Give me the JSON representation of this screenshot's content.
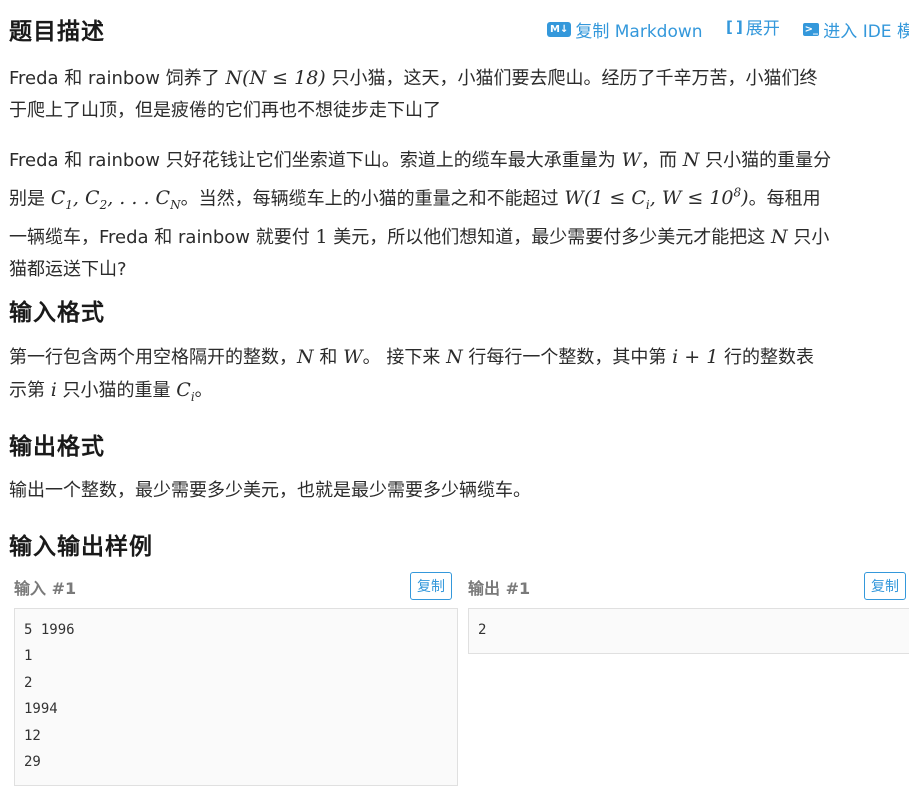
{
  "toolbar": {
    "md_icon": "M↓",
    "copy_markdown": "复制 Markdown",
    "expand_icon": "[ ]",
    "expand": "展开",
    "ide_icon": ">_",
    "ide": "进入 IDE 模式"
  },
  "sections": {
    "description": "题目描述",
    "input_format": "输入格式",
    "output_format": "输出格式",
    "samples": "输入输出样例"
  },
  "description": {
    "p1": {
      "t1": "Freda 和 rainbow 饲养了 ",
      "m1": "N(N ≤ 18)",
      "t2": " 只小猫，这天，小猫们要去爬山。经历了千辛万苦，小猫们终",
      "line2": "于爬上了山顶，但是疲倦的它们再也不想徒步走下山了"
    },
    "p2": {
      "t1": "Freda 和 rainbow 只好花钱让它们坐索道下山。索道上的缆车最大承重量为 ",
      "m_w": "W",
      "t2": "，而 ",
      "m_n": "N",
      "t3": " 只小猫的重量分",
      "t4": "别是 ",
      "m_c": "C",
      "c1": "1",
      "comma1": ", ",
      "c2": "2",
      "dots": ", . . . ",
      "cn": "N",
      "t5": "。当然，每辆缆车上的小猫的重量之和不能超过 ",
      "m_wcond1": "W(1 ≤ C",
      "sub_i": "i",
      "m_wcond2": ", W ≤ 10",
      "sup8": "8",
      "m_wcond3": ")",
      "t6": "。每租用",
      "t7": "一辆缆车，Freda 和 rainbow 就要付 ",
      "one": "1",
      "t8": " 美元，所以他们想知道，最少需要付多少美元才能把这 ",
      "t9": " 只小",
      "t10": "猫都运送下山?"
    }
  },
  "input_format": {
    "t1": "第一行包含两个用空格隔开的整数，",
    "n": "N",
    "t2": " 和 ",
    "w": "W",
    "t3": "。 接下来 ",
    "t4": " 行每行一个整数，其中第 ",
    "i_plus_1": "i + 1",
    "t5": " 行的整数表",
    "t6": "示第 ",
    "i": "i",
    "t7": " 只小猫的重量 ",
    "c": "C",
    "ci_sub": "i",
    "t8": "。"
  },
  "output_format": {
    "text": "输出一个整数，最少需要多少美元，也就是最少需要多少辆缆车。"
  },
  "samples": {
    "input_title": "输入 #1",
    "output_title": "输出 #1",
    "copy_label": "复制",
    "input_lines": [
      "5 1996",
      "1",
      "2",
      "1994",
      "12",
      "29"
    ],
    "output_lines": [
      "2"
    ]
  }
}
